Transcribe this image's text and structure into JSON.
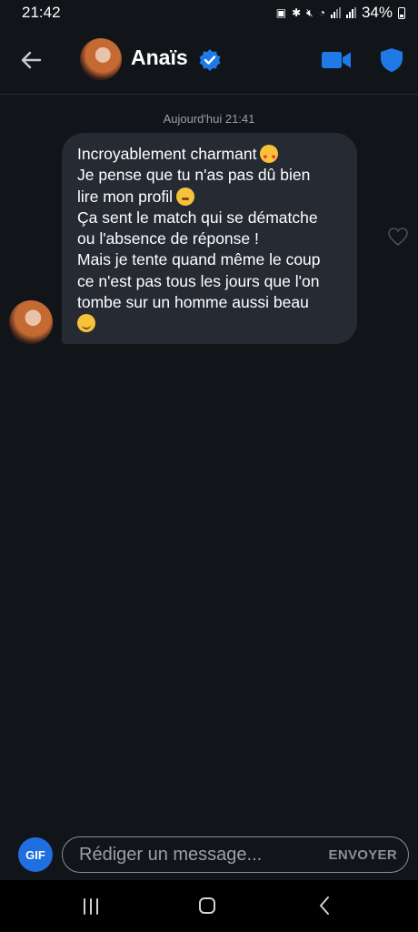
{
  "status_bar": {
    "time": "21:42",
    "battery": "34%"
  },
  "header": {
    "contact_name": "Anaïs",
    "verified": true
  },
  "chat": {
    "date_separator": "Aujourd'hui 21:41",
    "message": {
      "lines": [
        "Incroyablement charmant",
        "Je pense que tu n'as pas dû bien",
        "lire mon profil",
        "Ça sent le match qui se dématche",
        "ou l'absence de réponse !",
        "Mais je tente quand même le coup",
        "ce n'est pas tous les jours que l'on",
        "tombe sur un homme aussi beau"
      ],
      "emojis": [
        "heart-eyes",
        "flushed",
        "smiling"
      ]
    }
  },
  "composer": {
    "gif_label": "GIF",
    "placeholder": "Rédiger un message...",
    "send_label": "ENVOYER"
  },
  "colors": {
    "background": "#111419",
    "bubble": "#252a33",
    "accent": "#1f6fe0"
  }
}
